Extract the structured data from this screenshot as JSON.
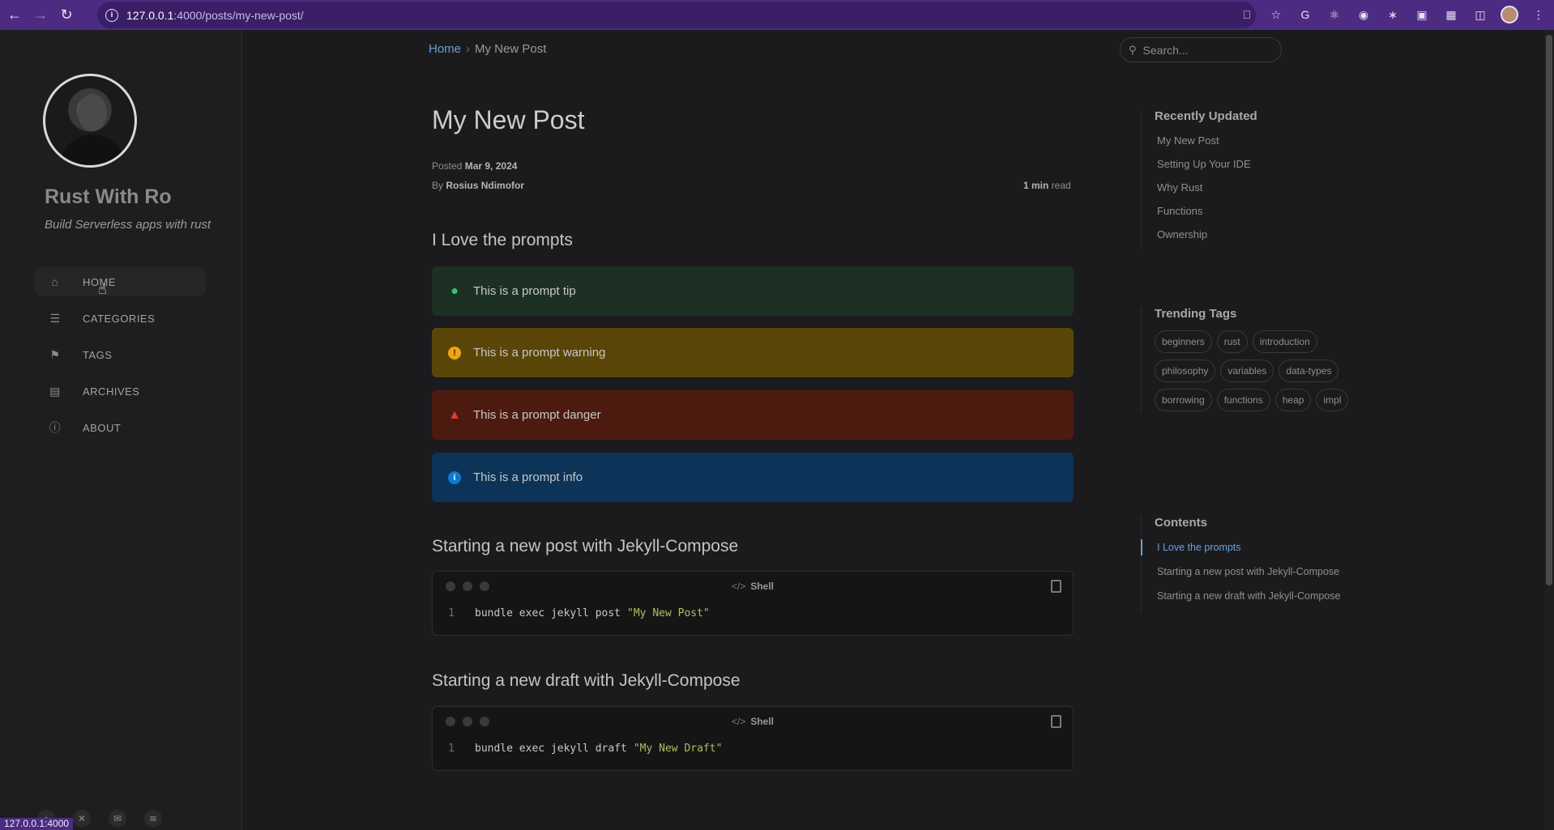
{
  "browser": {
    "url_host": "127.0.0.1",
    "url_path": ":4000/posts/my-new-post/",
    "status_url": "127.0.0.1:4000"
  },
  "sidebar": {
    "site_title": "Rust With Ro",
    "site_subtitle": "Build Serverless apps with rust",
    "nav": [
      {
        "label": "HOME",
        "icon": "home-icon",
        "active": true
      },
      {
        "label": "CATEGORIES",
        "icon": "bars-icon",
        "active": false
      },
      {
        "label": "TAGS",
        "icon": "tags-icon",
        "active": false
      },
      {
        "label": "ARCHIVES",
        "icon": "archive-icon",
        "active": false
      },
      {
        "label": "ABOUT",
        "icon": "info-icon",
        "active": false
      }
    ],
    "social": [
      "github-icon",
      "x-twitter-icon",
      "email-icon",
      "rss-icon"
    ]
  },
  "topbar": {
    "breadcrumb_home": "Home",
    "breadcrumb_sep": "›",
    "breadcrumb_current": "My New Post",
    "search_placeholder": "Search..."
  },
  "post": {
    "title": "My New Post",
    "posted_label": "Posted",
    "posted_date": "Mar 9, 2024",
    "by_label": "By",
    "author": "Rosius Ndimofor",
    "read_time": "1 min",
    "read_label": "read",
    "section1": "I Love the prompts",
    "prompts": [
      {
        "type": "tip",
        "text": "This is a prompt tip",
        "color": "#38c172"
      },
      {
        "type": "warning",
        "text": "This is a prompt warning",
        "color": "#f0a612"
      },
      {
        "type": "danger",
        "text": "This is a prompt danger",
        "color": "#df3c30"
      },
      {
        "type": "info",
        "text": "This is a prompt info",
        "color": "#0d7ad2"
      }
    ],
    "section2": "Starting a new post with Jekyll-Compose",
    "code1": {
      "lang": "Shell",
      "line": "1",
      "cmd": "bundle exec jekyll post",
      "str": "\"My New Post\""
    },
    "section3": "Starting a new draft with Jekyll-Compose",
    "code2": {
      "lang": "Shell",
      "line": "1",
      "cmd": "bundle exec jekyll draft",
      "str": "\"My New Draft\""
    }
  },
  "panel": {
    "recent_title": "Recently Updated",
    "recent": [
      "My New Post",
      "Setting Up Your IDE",
      "Why Rust",
      "Functions",
      "Ownership"
    ],
    "tags_title": "Trending Tags",
    "tags": [
      "beginners",
      "rust",
      "introduction",
      "philosophy",
      "variables",
      "data-types",
      "borrowing",
      "functions",
      "heap",
      "impl"
    ],
    "toc_title": "Contents",
    "toc": [
      "I Love the prompts",
      "Starting a new post with Jekyll-Compose",
      "Starting a new draft with Jekyll-Compose"
    ]
  },
  "colors": {
    "accent": "#68a0d9",
    "chrome": "#4c2b82"
  }
}
